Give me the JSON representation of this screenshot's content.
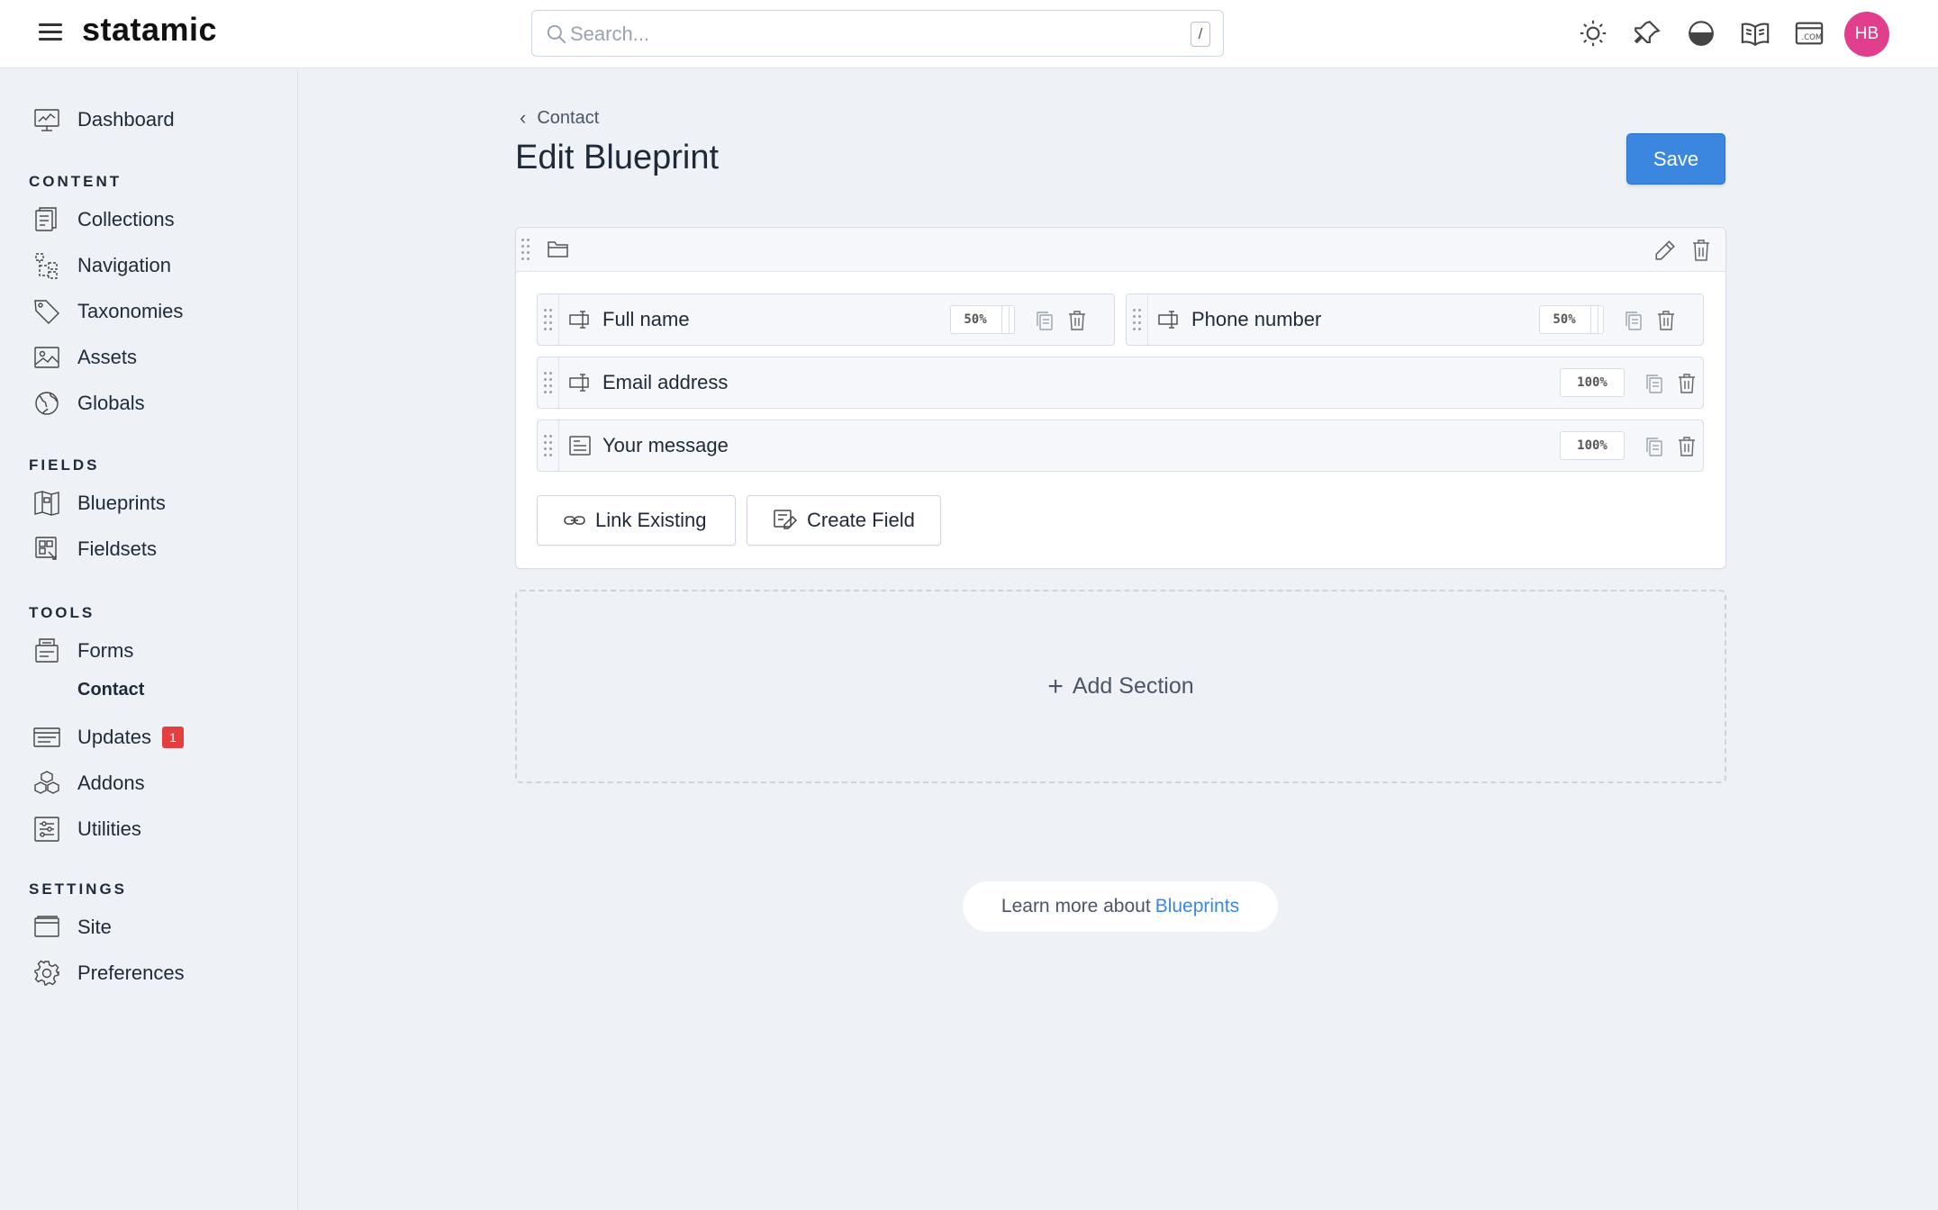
{
  "app": {
    "logo": "statamic"
  },
  "search": {
    "placeholder": "Search...",
    "shortcut": "/"
  },
  "user": {
    "initials": "HB",
    "avatar_color": "#e23e8e"
  },
  "sidebar": {
    "dashboard": "Dashboard",
    "sections": [
      {
        "heading": "CONTENT",
        "items": [
          "Collections",
          "Navigation",
          "Taxonomies",
          "Assets",
          "Globals"
        ]
      },
      {
        "heading": "FIELDS",
        "items": [
          "Blueprints",
          "Fieldsets"
        ]
      },
      {
        "heading": "TOOLS",
        "items": [
          "Forms",
          "Updates",
          "Addons",
          "Utilities"
        ],
        "subitem": "Contact",
        "updates_badge": "1"
      },
      {
        "heading": "SETTINGS",
        "items": [
          "Site",
          "Preferences"
        ]
      }
    ]
  },
  "page": {
    "breadcrumb": "Contact",
    "title": "Edit Blueprint",
    "save_label": "Save"
  },
  "fields": [
    {
      "label": "Full name",
      "width": "50%",
      "icon": "text-field-icon"
    },
    {
      "label": "Phone number",
      "width": "50%",
      "icon": "text-field-icon"
    },
    {
      "label": "Email address",
      "width": "100%",
      "icon": "text-field-icon"
    },
    {
      "label": "Your message",
      "width": "100%",
      "icon": "textarea-icon"
    }
  ],
  "actions": {
    "link_existing": "Link Existing",
    "create_field": "Create Field",
    "add_section": "Add Section"
  },
  "footer": {
    "learn_prefix": "Learn more about",
    "learn_link": "Blueprints"
  },
  "colors": {
    "accent": "#3b87e0",
    "badge": "#e53e3e",
    "background": "#eef2f7"
  }
}
